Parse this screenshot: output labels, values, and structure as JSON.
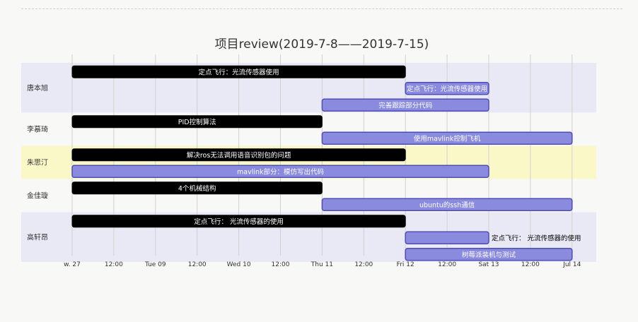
{
  "page": {
    "title": "项目review(2019-7-8——2019-7-15)"
  },
  "colors": {
    "section_odd": "#e9e9f5",
    "section_even": "#f8f8f6",
    "section_highlight": "#fbf8c8",
    "crit_fill": "#000000",
    "task_fill": "#8a8ade",
    "task_stroke": "#4d4db8",
    "grid": "#d0d0d0"
  },
  "chart_data": {
    "type": "gantt",
    "title": "项目review(2019-7-8——2019-7-15)",
    "x_range": [
      "2019-07-08 00:00",
      "2019-07-14 00:00"
    ],
    "ticks": [
      {
        "t": 0.0,
        "label": "w. 27"
      },
      {
        "t": 0.5,
        "label": "12:00"
      },
      {
        "t": 1.0,
        "label": "Tue 09"
      },
      {
        "t": 1.5,
        "label": "12:00"
      },
      {
        "t": 2.0,
        "label": "Wed 10"
      },
      {
        "t": 2.5,
        "label": "12:00"
      },
      {
        "t": 3.0,
        "label": "Thu 11"
      },
      {
        "t": 3.5,
        "label": "12:00"
      },
      {
        "t": 4.0,
        "label": "Fri 12"
      },
      {
        "t": 4.5,
        "label": "12:00"
      },
      {
        "t": 5.0,
        "label": "Sat 13"
      },
      {
        "t": 5.5,
        "label": "12:00"
      },
      {
        "t": 6.0,
        "label": "Jul 14"
      }
    ],
    "sections": [
      {
        "name": "唐本旭",
        "tasks": [
          {
            "label": "定点飞行：光流传感器使用",
            "start": "2019-07-08",
            "end": "2019-07-12",
            "crit": true
          },
          {
            "label": "定点飞行：光流传感器使用",
            "start": "2019-07-12",
            "end": "2019-07-13",
            "crit": false
          },
          {
            "label": "完善跟踪部分代码",
            "start": "2019-07-11",
            "end": "2019-07-13",
            "crit": false
          }
        ]
      },
      {
        "name": "李慕琦",
        "tasks": [
          {
            "label": "PID控制算法",
            "start": "2019-07-08",
            "end": "2019-07-11",
            "crit": true
          },
          {
            "label": "使用mavlink控制飞机",
            "start": "2019-07-11",
            "end": "2019-07-14",
            "crit": false
          }
        ]
      },
      {
        "name": "朱思汀",
        "tasks": [
          {
            "label": "解决ros无法调用语音识别包的问题",
            "start": "2019-07-08",
            "end": "2019-07-12",
            "crit": true
          },
          {
            "label": "mavlink部分：模仿写出代码",
            "start": "2019-07-08",
            "end": "2019-07-13",
            "crit": false
          }
        ]
      },
      {
        "name": "金佳璇",
        "tasks": [
          {
            "label": "4个机械结构",
            "start": "2019-07-08",
            "end": "2019-07-11",
            "crit": true
          },
          {
            "label": "ubuntu的ssh通信",
            "start": "2019-07-11",
            "end": "2019-07-14",
            "crit": false
          }
        ]
      },
      {
        "name": "高轩昂",
        "tasks": [
          {
            "label": "定点飞行： 光流传感器的使用",
            "start": "2019-07-08",
            "end": "2019-07-12",
            "crit": true
          },
          {
            "label": "定点飞行： 光流传感器的使用",
            "start": "2019-07-12",
            "end": "2019-07-13",
            "crit": false
          },
          {
            "label": "树莓派装机与测试",
            "start": "2019-07-12",
            "end": "2019-07-14",
            "crit": false
          }
        ]
      }
    ]
  }
}
